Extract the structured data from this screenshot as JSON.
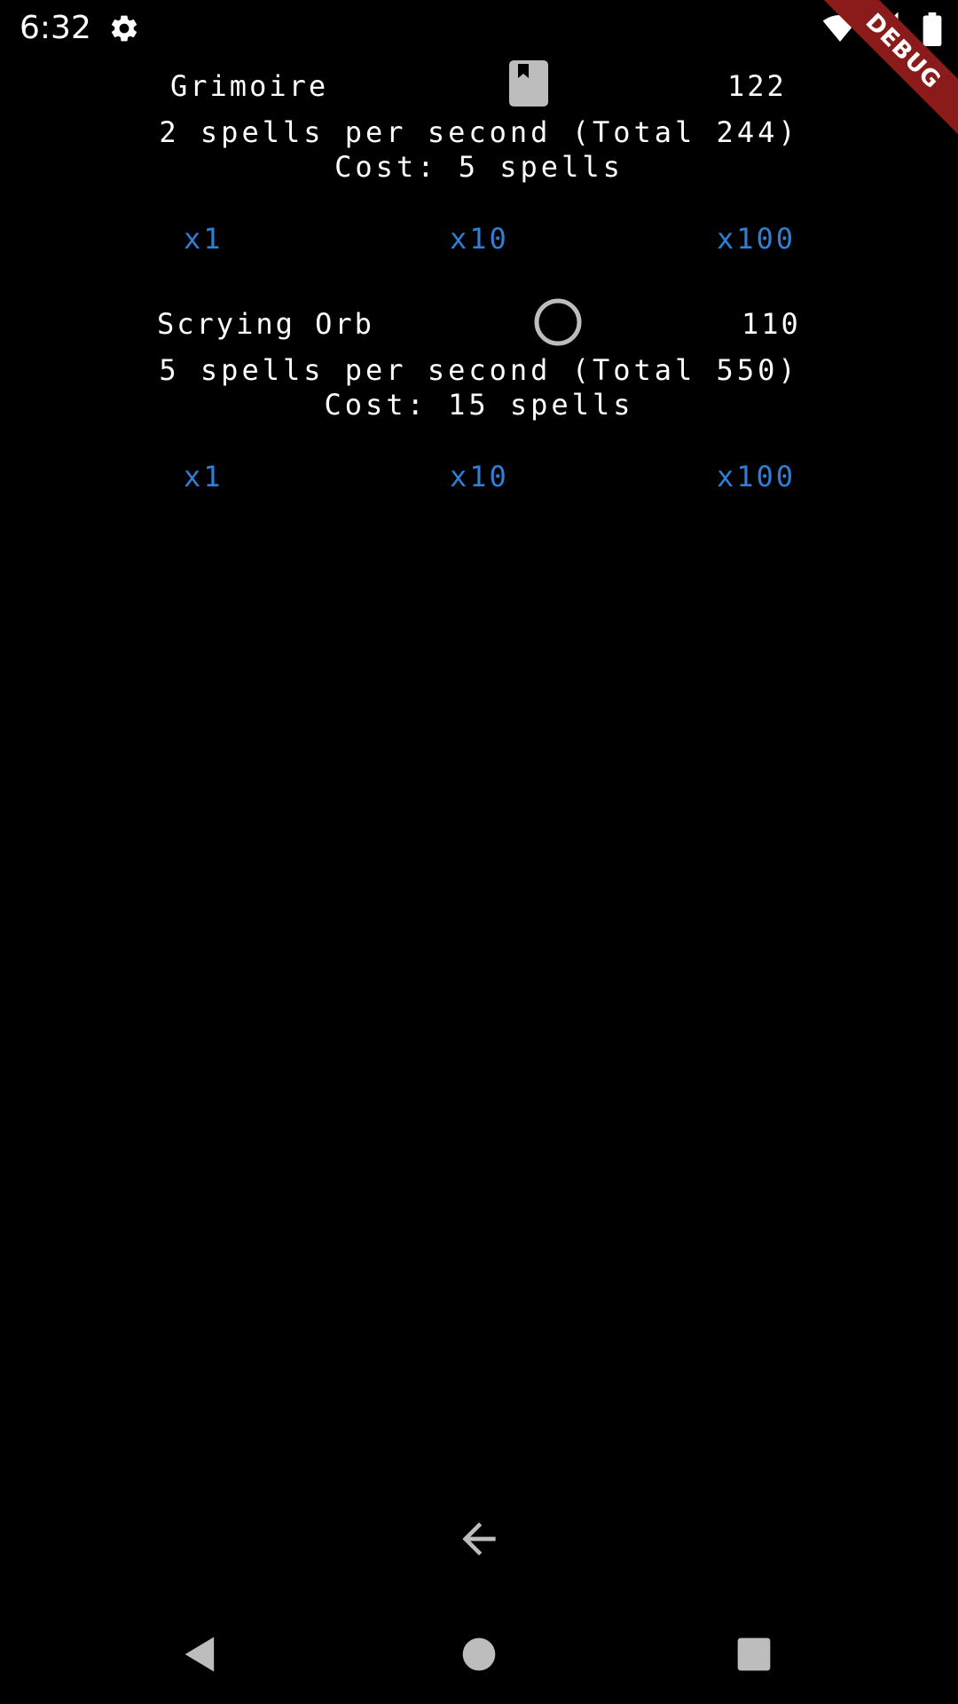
{
  "status_bar": {
    "time": "6:32",
    "icons": [
      "gear-icon",
      "wifi-icon",
      "signal-icon",
      "battery-icon"
    ]
  },
  "debug_banner": {
    "label": "DEBUG",
    "color": "#8b1a1a"
  },
  "items": [
    {
      "name": "Grimoire",
      "icon": "book-icon",
      "count": "122",
      "rate": "2 spells per second (Total 244)",
      "cost": "Cost: 5 spells",
      "buttons": [
        "x1",
        "x10",
        "x100"
      ]
    },
    {
      "name": "Scrying Orb",
      "icon": "orb-icon",
      "count": "110",
      "rate": "5 spells per second (Total 550)",
      "cost": "Cost: 15 spells",
      "buttons": [
        "x1",
        "x10",
        "x100"
      ]
    }
  ],
  "bottom": {
    "back_icon": "arrow-left-icon"
  },
  "nav_bar": {
    "icons": [
      "nav-back-icon",
      "nav-home-icon",
      "nav-recents-icon"
    ]
  },
  "colors": {
    "background": "#000000",
    "text": "#ffffff",
    "button": "#2f7fd6",
    "icon": "#bdbdbd"
  }
}
